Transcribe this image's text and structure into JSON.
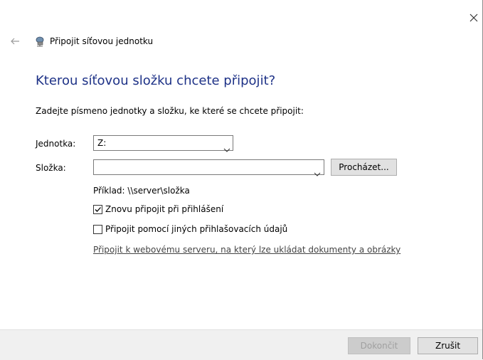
{
  "window": {
    "close_icon": "close-icon",
    "back_icon": "back-arrow-icon"
  },
  "header": {
    "icon": "network-drive-icon",
    "title": "Připojit síťovou jednotku"
  },
  "main": {
    "heading": "Kterou síťovou složku chcete připojit?",
    "instruction": "Zadejte písmeno jednotky a složku, ke které se chcete připojit:",
    "drive_label": "Jednotka:",
    "drive_value": "Z:",
    "folder_label": "Složka:",
    "folder_value": "",
    "browse_button": "Procházet...",
    "example": "Příklad: \\\\server\\složka",
    "reconnect_label": "Znovu připojit při přihlášení",
    "reconnect_checked": true,
    "other_credentials_label": "Připojit pomocí jiných přihlašovacích údajů",
    "other_credentials_checked": false,
    "web_link": "Připojit k webovému serveru, na který lze ukládat dokumenty a obrázky"
  },
  "footer": {
    "finish_button": "Dokončit",
    "finish_disabled": true,
    "cancel_button": "Zrušit"
  },
  "colors": {
    "heading": "#1e3287",
    "footer_bg": "#f0f0f0"
  }
}
